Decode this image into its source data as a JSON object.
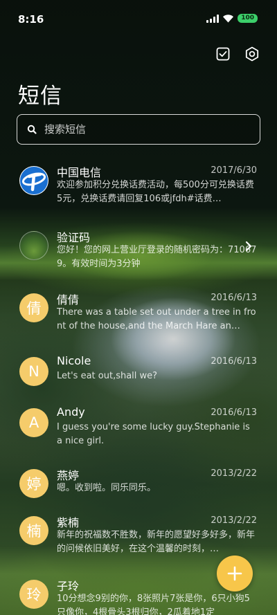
{
  "status_bar": {
    "time": "8:16",
    "battery": "100",
    "icons": [
      "signal-icon",
      "wifi-icon",
      "battery-icon"
    ]
  },
  "header": {
    "title": "短信",
    "actions": [
      "select-icon",
      "settings-icon"
    ]
  },
  "search": {
    "placeholder": "搜索短信"
  },
  "messages": [
    {
      "sender": "中国电信",
      "date": "2017/6/30",
      "preview": "欢迎参加积分兑换话费活动，每500分可兑换话费5元，兑换话费请回复106或jfdh#话费…",
      "avatar": "china-telecom-logo"
    },
    {
      "sender": "验证码",
      "date": "",
      "preview": "您好！您的网上营业厅登录的随机密码为：710679。有效时间为3分钟",
      "avatar": "photo"
    },
    {
      "sender": "倩倩",
      "date": "2016/6/13",
      "preview": "There was a table set out under a tree in front of the house,and the March Hare an…",
      "avatar": "倩"
    },
    {
      "sender": "Nicole",
      "date": "2016/6/13",
      "preview": "Let's eat out,shall we?",
      "avatar": "N"
    },
    {
      "sender": "Andy",
      "date": "2016/6/13",
      "preview": "I guess you're some lucky guy.Stephanie is a nice girl.",
      "avatar": "A"
    },
    {
      "sender": "燕婷",
      "date": "2013/2/22",
      "preview": "嗯。收到啦。同乐同乐。",
      "avatar": "婷"
    },
    {
      "sender": "紫楠",
      "date": "2013/2/22",
      "preview": "新年的祝福数不胜数，新年的愿望好多好多，新年的问候依旧美好，在这个温馨的时刻，…",
      "avatar": "楠"
    },
    {
      "sender": "子玲",
      "date": "",
      "preview": "10分想念9别的你，8张照片7张是你，6只小狗5只像你，4根骨头3根归你，2瓜着地1定",
      "avatar": "玲"
    }
  ],
  "fab": {
    "icon": "plus-icon"
  },
  "colors": {
    "accent": "#f7c64a",
    "avatar": "#f5cc6b",
    "battery": "#3ccf6a"
  }
}
